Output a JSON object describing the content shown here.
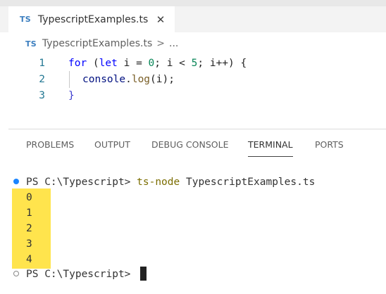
{
  "tab": {
    "icon": "TS",
    "label": "TypescriptExamples.ts"
  },
  "breadcrumb": {
    "icon": "TS",
    "file": "TypescriptExamples.ts",
    "sep": ">",
    "more": "..."
  },
  "editor": {
    "line_numbers": [
      "1",
      "2",
      "3"
    ],
    "line1": {
      "kw_for": "for",
      "open": " (",
      "kw_let": "let",
      "mid1": " i = ",
      "zero": "0",
      "mid2": "; i < ",
      "five": "5",
      "end": "; i++) {"
    },
    "line2": {
      "obj": "console",
      "dot": ".",
      "fn": "log",
      "args": "(i);"
    },
    "line3": {
      "close": "}"
    }
  },
  "panel_tabs": [
    "PROBLEMS",
    "OUTPUT",
    "DEBUG CONSOLE",
    "TERMINAL",
    "PORTS"
  ],
  "active_panel_tab": "TERMINAL",
  "terminal": {
    "prompt": "PS C:\\Typescript> ",
    "command": "ts-node",
    "command_arg": " TypescriptExamples.ts",
    "output": [
      "0",
      "1",
      "2",
      "3",
      "4"
    ],
    "prompt2": "PS C:\\Typescript> ",
    "highlight_color": "#ffe44d"
  }
}
